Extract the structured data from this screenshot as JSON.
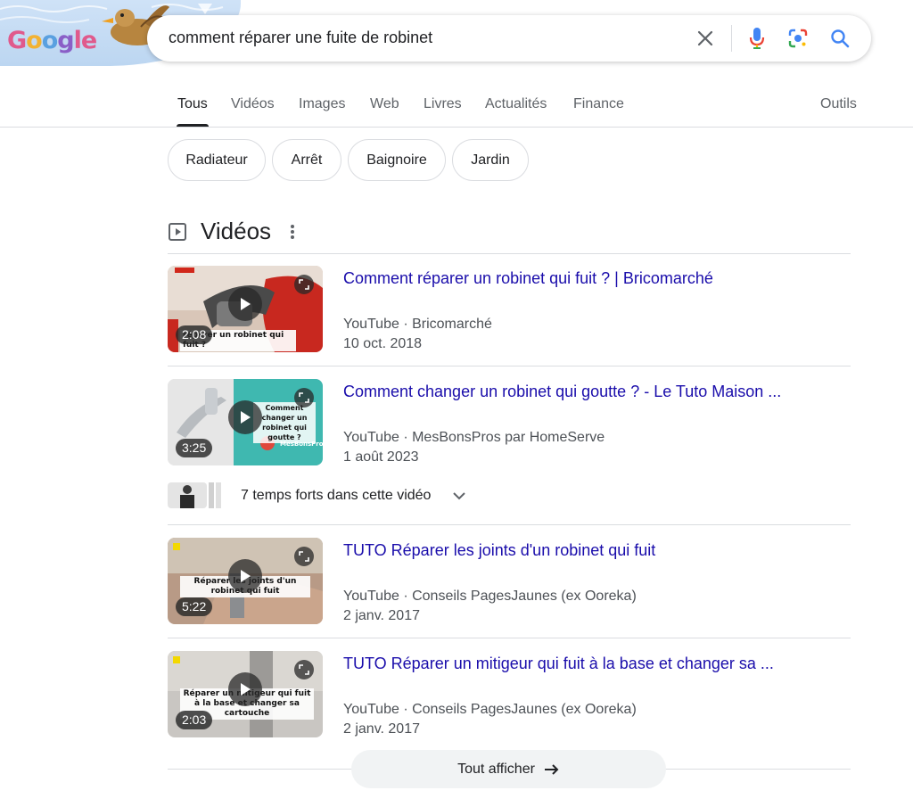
{
  "header": {
    "logo_text": "Google",
    "query": "comment réparer une fuite de robinet"
  },
  "tabs": [
    {
      "label": "Tous",
      "active": true
    },
    {
      "label": "Vidéos"
    },
    {
      "label": "Images"
    },
    {
      "label": "Web"
    },
    {
      "label": "Livres"
    },
    {
      "label": "Actualités"
    },
    {
      "label": "Finance"
    }
  ],
  "tools_label": "Outils",
  "chips": [
    "Radiateur",
    "Arrêt",
    "Baignoire",
    "Jardin"
  ],
  "videos_section": {
    "title": "Vidéos",
    "items": [
      {
        "title": "Comment réparer un robinet qui fuit ? | Bricomarché",
        "meta": "YouTube · Bricomarché",
        "date": "10 oct. 2018",
        "duration": "2:08",
        "thumb_text": "réparer un robinet qui fuit ?"
      },
      {
        "title": "Comment changer un robinet qui goutte ? - Le Tuto Maison ...",
        "meta": "YouTube · MesBonsPros par HomeServe",
        "date": "1 août 2023",
        "duration": "3:25",
        "thumb_text": "Comment changer un robinet qui goutte ?",
        "thumb_brand": "MesBonsPros"
      },
      {
        "title": "TUTO Réparer les joints d'un robinet qui fuit",
        "meta": "YouTube · Conseils PagesJaunes (ex Ooreka)",
        "date": "2 janv. 2017",
        "duration": "5:22",
        "thumb_text": "Réparer les joints d'un robinet qui fuit"
      },
      {
        "title": "TUTO Réparer un mitigeur qui fuit à la base et changer sa ...",
        "meta": "YouTube · Conseils PagesJaunes (ex Ooreka)",
        "date": "2 janv. 2017",
        "duration": "2:03",
        "thumb_text": "Réparer un mitigeur qui fuit à la base et changer sa cartouche"
      }
    ],
    "key_moments": "7 temps forts dans cette vidéo",
    "show_all": "Tout afficher"
  }
}
